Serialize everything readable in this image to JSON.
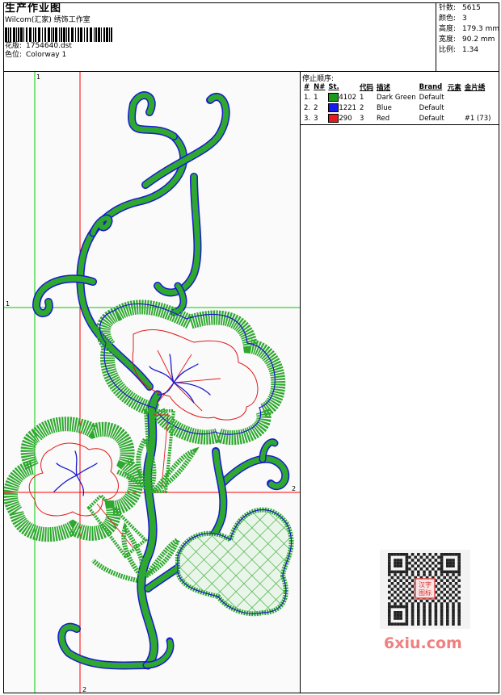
{
  "header": {
    "title": "生产作业图",
    "subtitle": "Wilcom(汇家) 绣饰工作室",
    "design_label": "花版:",
    "design_value": "1754640.dst",
    "colorway_label": "色位:",
    "colorway_value": "Colorway 1"
  },
  "stats": [
    {
      "label": "针数:",
      "value": "5615"
    },
    {
      "label": "颜色:",
      "value": "3"
    },
    {
      "label": "高度:",
      "value": "179.3 mm"
    },
    {
      "label": "宽度:",
      "value": "90.2 mm"
    },
    {
      "label": "比例:",
      "value": "1.34"
    }
  ],
  "stop_sequence": {
    "title": "停止顺序:",
    "columns": [
      "#",
      "N#",
      "St.",
      "代码",
      "描述",
      "Brand",
      "元素",
      "金片绣"
    ],
    "rows": [
      {
        "num": "1.",
        "n": "1",
        "color": "#1a9a1a",
        "stitches": "4102",
        "code": "1",
        "desc": "Dark Green",
        "brand": "Default",
        "elem": "",
        "seq": ""
      },
      {
        "num": "2.",
        "n": "2",
        "color": "#1a1ae6",
        "stitches": "1221",
        "code": "2",
        "desc": "Blue",
        "brand": "Default",
        "elem": "",
        "seq": ""
      },
      {
        "num": "3.",
        "n": "3",
        "color": "#e61a1a",
        "stitches": "290",
        "code": "3",
        "desc": "Red",
        "brand": "Default",
        "elem": "",
        "seq": "#1 (73)"
      }
    ]
  },
  "guides": {
    "v1_label": "1",
    "h1_label": "1",
    "h2_label": "2",
    "v2_label": "2"
  },
  "watermark": "6xiu.com",
  "qr_stamp": "汉字图标",
  "colors": {
    "thread_green": "#2ea82e",
    "thread_blue": "#1a1ad0",
    "thread_red": "#e01a1a",
    "guide_green": "#00cc00",
    "guide_red": "#ff0000"
  }
}
